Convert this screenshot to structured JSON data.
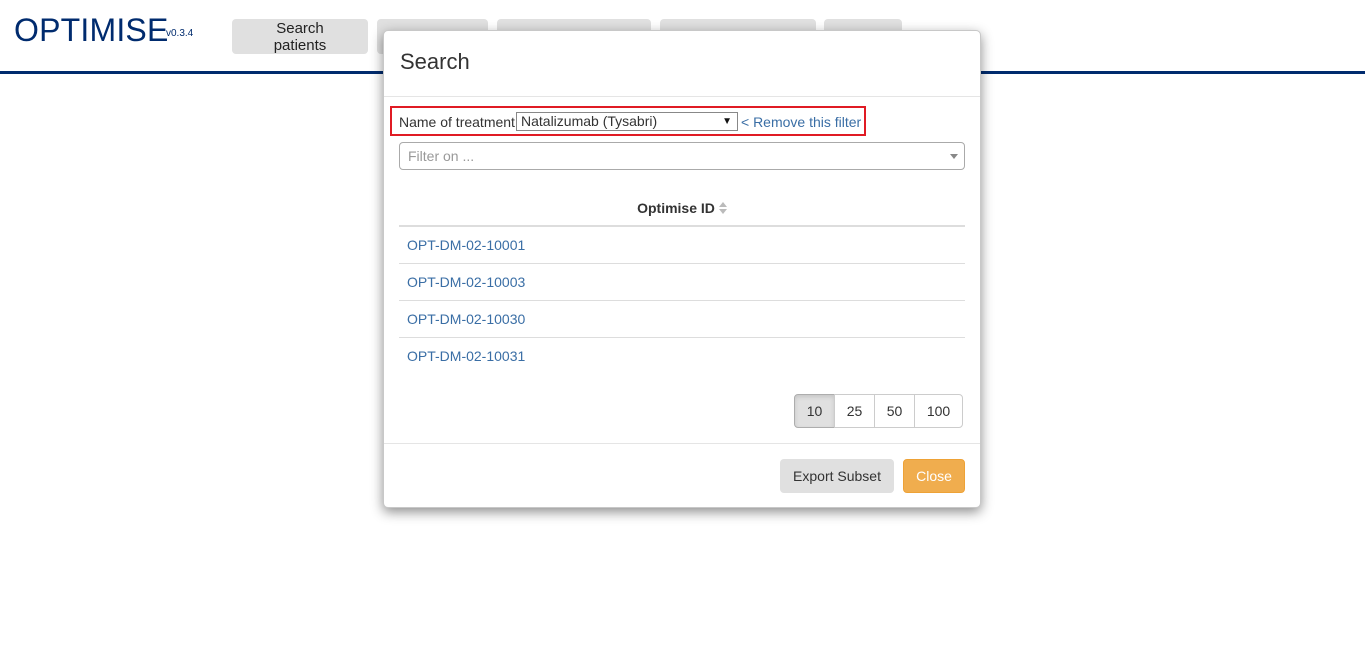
{
  "app": {
    "title": "OPTIMISE",
    "version": "v0.3.4"
  },
  "nav": {
    "search_patients": "Search patients"
  },
  "modal": {
    "title": "Search",
    "filter": {
      "label": "Name of treatment",
      "selected_value": "Natalizumab (Tysabri)",
      "remove_link": "< Remove this filter"
    },
    "filter_on": {
      "placeholder": "Filter on ..."
    },
    "table": {
      "column_header": "Optimise ID",
      "rows": [
        "OPT-DM-02-10001",
        "OPT-DM-02-10003",
        "OPT-DM-02-10030",
        "OPT-DM-02-10031"
      ]
    },
    "page_sizes": [
      "10",
      "25",
      "50",
      "100"
    ],
    "active_page_size": "10",
    "export_label": "Export Subset",
    "close_label": "Close"
  },
  "colors": {
    "brand": "#002b6e",
    "link": "#3a6ea5",
    "highlight": "#e01b24",
    "close_button": "#f0ad4e"
  }
}
